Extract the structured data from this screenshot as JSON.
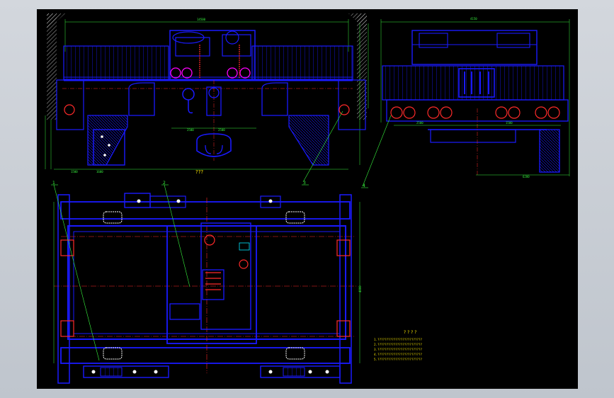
{
  "drawing": {
    "callouts": [
      "1",
      "2",
      "3",
      "4"
    ],
    "tech_title": "? ? ? ?",
    "tech_lines": [
      "1.?????????????????????????",
      "2.?????????????????????????",
      "3.?????????????????????????",
      "4.?????????????????????????",
      "5.?????????????????????????"
    ],
    "front_view_caption": "???",
    "colors": {
      "background": "#000000",
      "structure": "#1a1aff",
      "dimension": "#37f23d",
      "centerline": "#ff2a2a",
      "hatch": "#d9d9d9",
      "notes": "#f5e400",
      "highlight": "#ff00ff",
      "accent": "#00e5ff"
    }
  }
}
